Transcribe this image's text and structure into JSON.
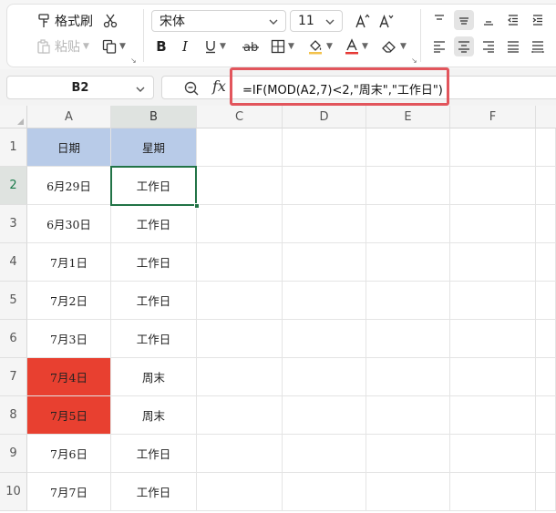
{
  "ribbon": {
    "format_painter_label": "格式刷",
    "paste_label": "粘贴",
    "font_name": "宋体",
    "font_size": "11"
  },
  "formula_bar": {
    "name_box": "B2",
    "fx_label": "fx",
    "formula": "=IF(MOD(A2,7)<2,\"周末\",\"工作日\")"
  },
  "columns": [
    "A",
    "B",
    "C",
    "D",
    "E",
    "F"
  ],
  "rows": [
    "1",
    "2",
    "3",
    "4",
    "5",
    "6",
    "7",
    "8",
    "9",
    "10"
  ],
  "cells": {
    "A1": "日期",
    "B1": "星期",
    "A2": "6月29日",
    "B2": "工作日",
    "A3": "6月30日",
    "B3": "工作日",
    "A4": "7月1日",
    "B4": "工作日",
    "A5": "7月2日",
    "B5": "工作日",
    "A6": "7月3日",
    "B6": "工作日",
    "A7": "7月4日",
    "B7": "周末",
    "A8": "7月5日",
    "B8": "周末",
    "A9": "7月6日",
    "B9": "工作日",
    "A10": "7月7日",
    "B10": "工作日"
  },
  "colors": {
    "header_fill": "#b8cbe8",
    "weekend_fill": "#e84030",
    "selection": "#217346",
    "annotation_box": "#e2555c"
  }
}
